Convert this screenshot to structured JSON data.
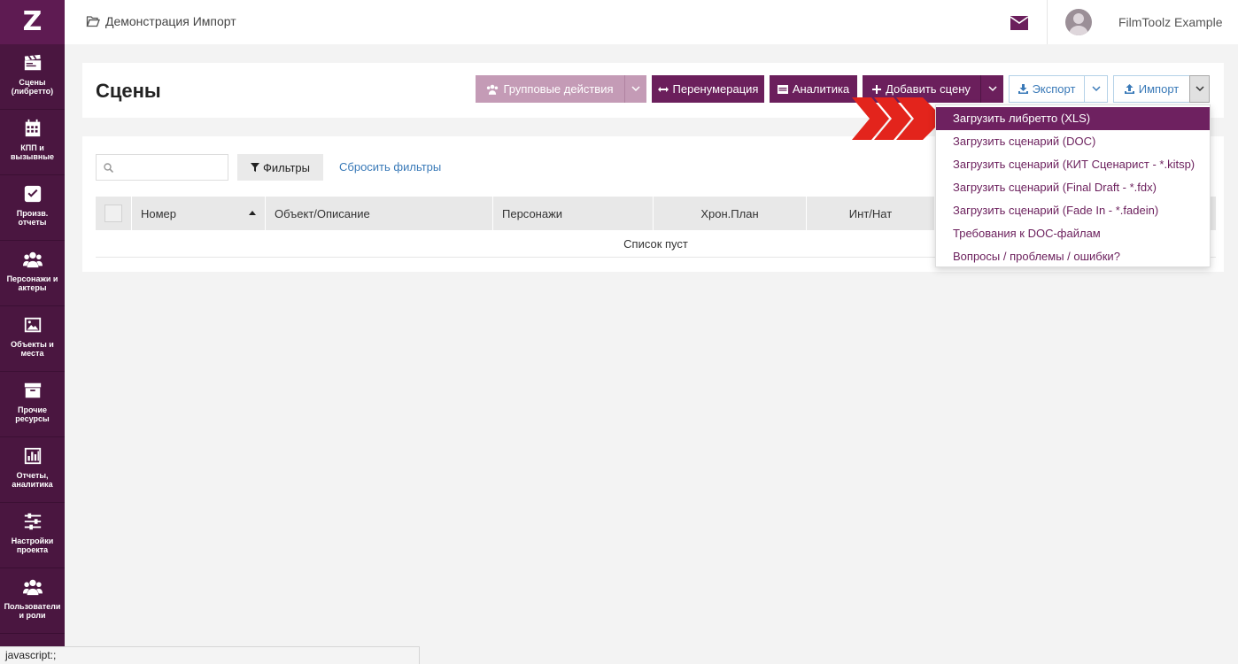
{
  "app": {
    "logo": "Z"
  },
  "sidebar": {
    "items": [
      {
        "label": "Сцены (либретто)",
        "icon": "clapperboard-icon"
      },
      {
        "label": "КПП и вызывные",
        "icon": "calendar-icon"
      },
      {
        "label": "Произв. отчеты",
        "icon": "checkbox-icon"
      },
      {
        "label": "Персонажи и актеры",
        "icon": "users-icon"
      },
      {
        "label": "Объекты и места",
        "icon": "image-icon"
      },
      {
        "label": "Прочие ресурсы",
        "icon": "archive-box-icon"
      },
      {
        "label": "Отчеты, аналитика",
        "icon": "bar-chart-icon"
      },
      {
        "label": "Настройки проекта",
        "icon": "sliders-icon"
      },
      {
        "label": "Пользователи и роли",
        "icon": "users-icon"
      }
    ]
  },
  "topbar": {
    "project_name": "Демонстрация Импорт",
    "user_name": "FilmToolz Example"
  },
  "header": {
    "title": "Сцены",
    "buttons": {
      "group_actions": "Групповые действия",
      "renumber": "Перенумерация",
      "analytics": "Аналитика",
      "add_scene": "Добавить сцену",
      "export": "Экспорт",
      "import": "Импорт"
    }
  },
  "filters": {
    "search_placeholder": "",
    "filters_button": "Фильтры",
    "reset_link": "Сбросить фильтры"
  },
  "table": {
    "columns": [
      "Номер",
      "Объект/Описание",
      "Персонажи",
      "Хрон.План",
      "Инт/Нат"
    ],
    "empty_text": "Список пуст"
  },
  "import_menu": {
    "items": [
      "Загрузить либретто (XLS)",
      "Загрузить сценарий (DOC)",
      "Загрузить сценарий (КИТ Сценарист - *.kitsp)",
      "Загрузить сценарий (Final Draft - *.fdx)",
      "Загрузить сценарий (Fade In - *.fadein)",
      "Требования к DOC-файлам",
      "Вопросы / проблемы / ошибки?"
    ],
    "active_index": 0
  },
  "status_bar": {
    "text": "javascript:;"
  },
  "colors": {
    "sidebar": "#4a1640",
    "primary": "#6b1f5c",
    "primary_disabled": "#c49bb6",
    "link": "#3a7ab8",
    "arrow": "#e3241c"
  }
}
